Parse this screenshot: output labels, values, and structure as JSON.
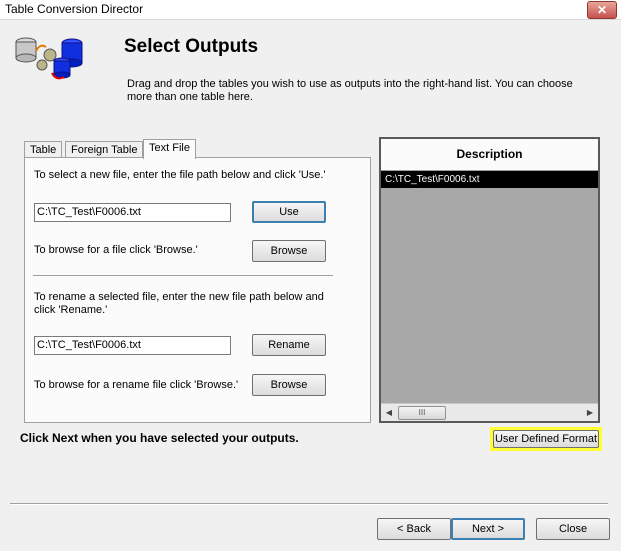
{
  "window": {
    "title": "Table Conversion Director",
    "close_glyph": "✕"
  },
  "header": {
    "title": "Select Outputs",
    "instructions": "Drag and drop the tables you wish to use as outputs into the right-hand list.  You can choose more than one table here."
  },
  "tabs": [
    {
      "label": "Table",
      "active": false
    },
    {
      "label": "Foreign Table",
      "active": false
    },
    {
      "label": "Text File",
      "active": true
    }
  ],
  "text_file_panel": {
    "select_instruction": "To select a new file, enter the file path below and click 'Use.'",
    "file_path_value": "C:\\TC_Test\\F0006.txt",
    "use_button": "Use",
    "browse_instruction": "To browse for a file click 'Browse.'",
    "browse_button": "Browse",
    "rename_instruction": "To rename a selected file, enter the new file path below and click 'Rename.'",
    "rename_path_value": "C:\\TC_Test\\F0006.txt",
    "rename_button": "Rename",
    "rename_browse_instruction": "To browse for a rename file click 'Browse.'",
    "rename_browse_button": "Browse"
  },
  "output_list": {
    "header": "Description",
    "items": [
      "C:\\TC_Test\\F0006.txt"
    ],
    "scroll_left": "◀",
    "scroll_right": "▶",
    "thumb_grip": "III"
  },
  "footer": {
    "hint": "Click Next when you have selected your outputs.",
    "user_defined_format_button": "User Defined Format",
    "back_button": "< Back",
    "next_button": "Next >",
    "close_button": "Close"
  },
  "colors": {
    "highlight": "#ffff33",
    "selection": "#000000",
    "list_background": "#a8a8a8"
  },
  "icons": {
    "logo": "database-conversion-icon"
  }
}
